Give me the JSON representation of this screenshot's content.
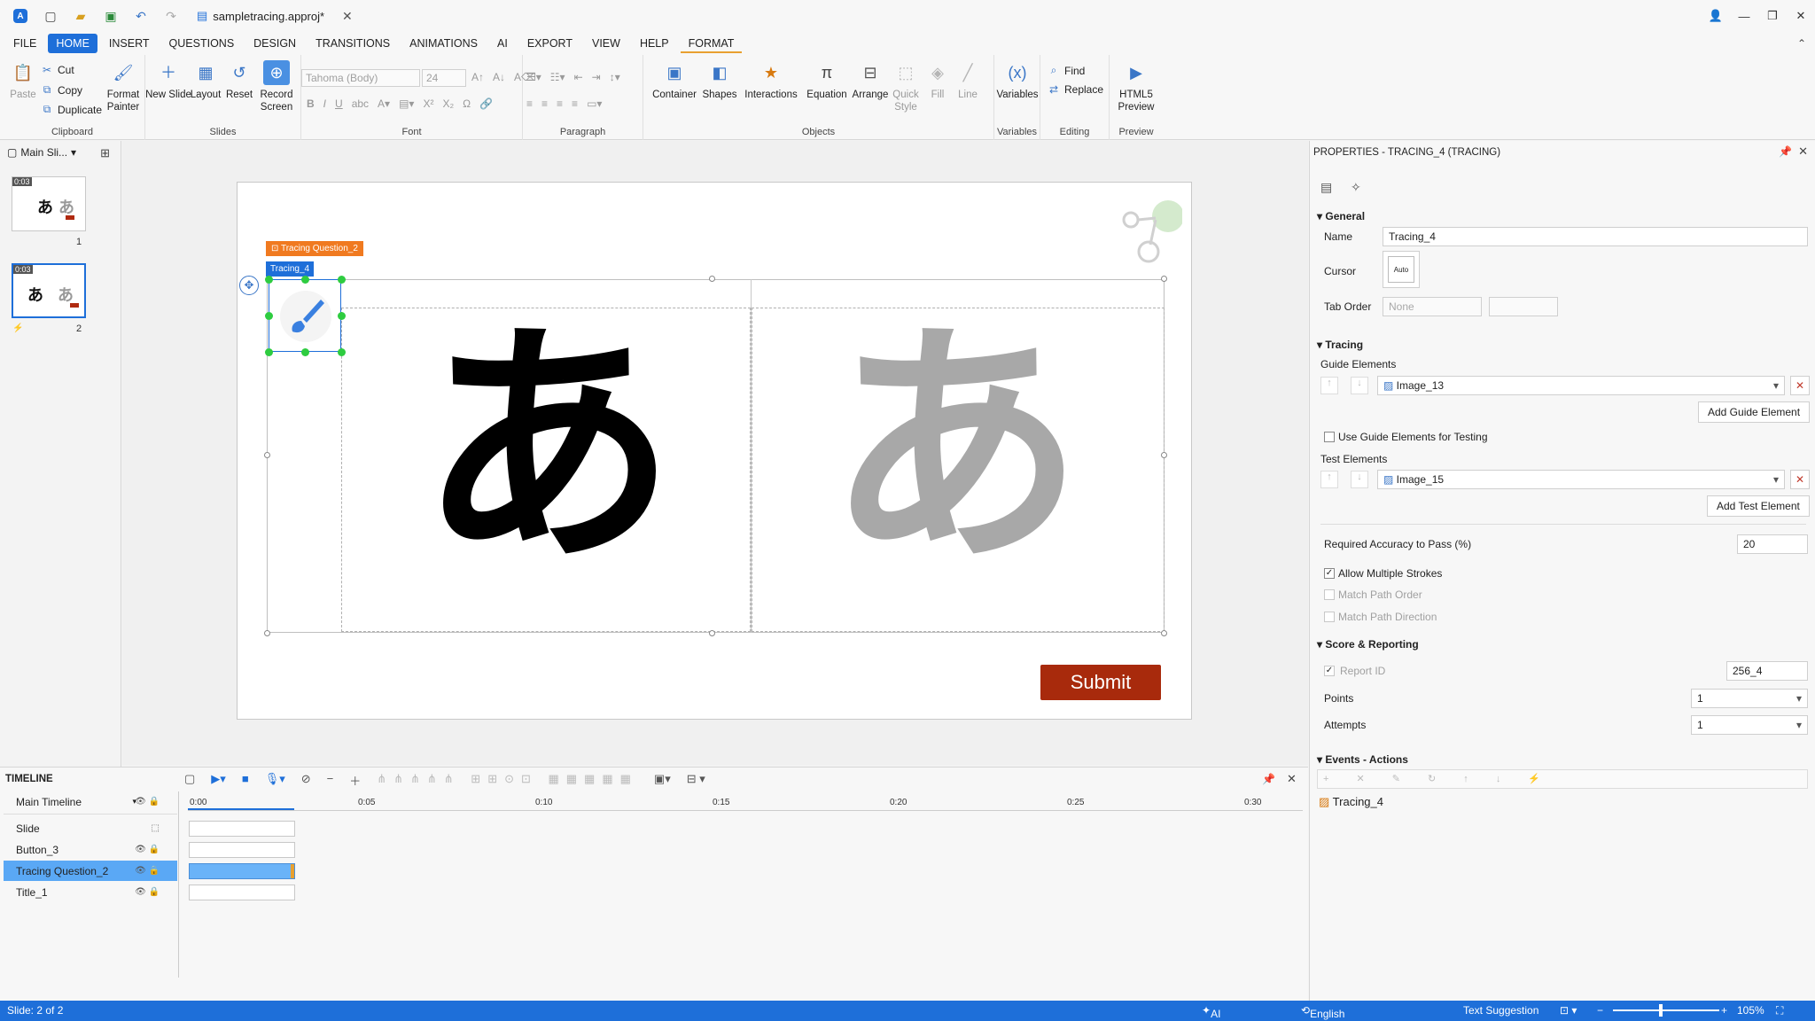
{
  "titlebar": {
    "document_name": "sampletracing.approj*"
  },
  "menu": {
    "items": [
      "FILE",
      "HOME",
      "INSERT",
      "QUESTIONS",
      "DESIGN",
      "TRANSITIONS",
      "ANIMATIONS",
      "AI",
      "EXPORT",
      "VIEW",
      "HELP",
      "FORMAT"
    ],
    "active": "HOME"
  },
  "ribbon": {
    "clipboard": {
      "paste": "Paste",
      "cut": "Cut",
      "copy": "Copy",
      "duplicate": "Duplicate",
      "format_painter": "Format Painter",
      "label": "Clipboard"
    },
    "slides": {
      "new_slide": "New Slide",
      "layout": "Layout",
      "reset": "Reset",
      "record_screen": "Record Screen",
      "label": "Slides"
    },
    "font": {
      "family": "Tahoma (Body)",
      "size": "24",
      "label": "Font"
    },
    "paragraph": {
      "label": "Paragraph"
    },
    "objects": {
      "container": "Container",
      "shapes": "Shapes",
      "interactions": "Interactions",
      "equation": "Equation",
      "arrange": "Arrange",
      "quick_style": "Quick Style",
      "fill": "Fill",
      "line": "Line",
      "label": "Objects"
    },
    "variables": {
      "variables": "Variables",
      "label": "Variables"
    },
    "editing": {
      "find": "Find",
      "replace": "Replace",
      "label": "Editing"
    },
    "preview": {
      "html5_preview": "HTML5 Preview",
      "label": "Preview"
    }
  },
  "slide_panel": {
    "header": "Main Sli...",
    "slides": [
      {
        "number": "1",
        "duration": "0:03",
        "char1": "あ",
        "char2": "あ"
      },
      {
        "number": "2",
        "duration": "0:03",
        "char1": "あ",
        "char2": "あ"
      }
    ]
  },
  "canvas": {
    "question_tag": "Tracing Question_2",
    "tracing_tag": "Tracing_4",
    "char_solid": "あ",
    "char_guide": "あ",
    "submit_label": "Submit",
    "colors": {
      "tag_orange": "#f07a20",
      "tag_blue": "#1e6fd9",
      "submit_red": "#a82a0c",
      "guide_gray": "#a8a8a8"
    }
  },
  "properties": {
    "title": "PROPERTIES - TRACING_4 (TRACING)",
    "general": {
      "header": "General",
      "name_label": "Name",
      "name_value": "Tracing_4",
      "cursor_label": "Cursor",
      "cursor_value": "Auto",
      "tab_order_label": "Tab Order",
      "tab_order_value": "None"
    },
    "tracing": {
      "header": "Tracing",
      "guide_elements_label": "Guide Elements",
      "guide_element_value": "Image_13",
      "add_guide_button": "Add Guide Element",
      "use_guide_label": "Use Guide Elements for Testing",
      "test_elements_label": "Test Elements",
      "test_element_value": "Image_15",
      "add_test_button": "Add Test Element",
      "accuracy_label": "Required Accuracy to Pass (%)",
      "accuracy_value": "20",
      "allow_multiple_label": "Allow Multiple Strokes",
      "match_order_label": "Match Path Order",
      "match_direction_label": "Match Path Direction"
    },
    "score": {
      "header": "Score & Reporting",
      "report_id_label": "Report ID",
      "report_id_value": "256_4",
      "points_label": "Points",
      "points_value": "1",
      "attempts_label": "Attempts",
      "attempts_value": "1"
    },
    "events": {
      "header": "Events - Actions",
      "item": "Tracing_4"
    }
  },
  "timeline": {
    "title": "TIMELINE",
    "main_timeline": "Main Timeline",
    "rows": [
      "Slide",
      "Button_3",
      "Tracing Question_2",
      "Title_1"
    ],
    "ruler": [
      "0:00",
      "0:05",
      "0:10",
      "0:15",
      "0:20",
      "0:25",
      "0:30"
    ]
  },
  "statusbar": {
    "slide_info": "Slide: 2 of 2",
    "ai_assistant": "AI Assistant",
    "language": "English (United States)",
    "text_suggestion": "Text Suggestion",
    "zoom": "105%"
  }
}
